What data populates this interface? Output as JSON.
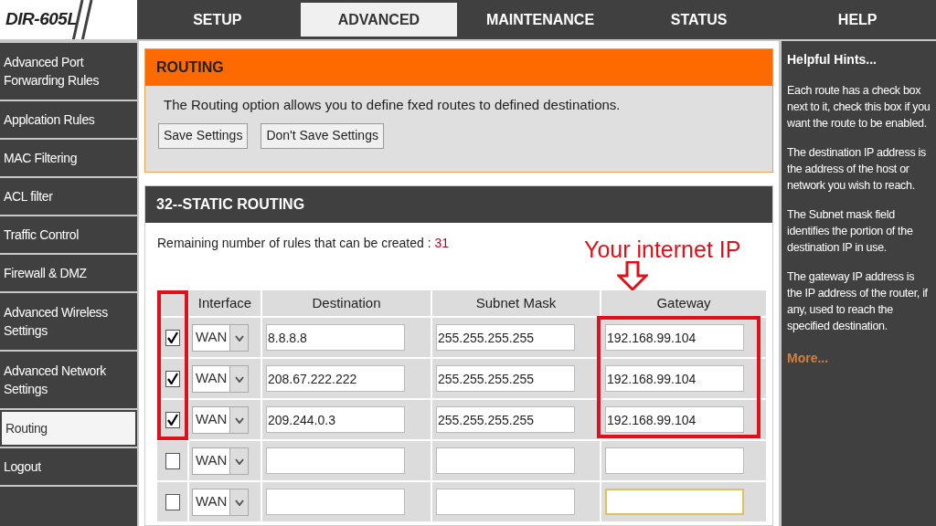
{
  "logo": "DIR-605L",
  "tabs": [
    {
      "label": "SETUP",
      "selected": false
    },
    {
      "label": "ADVANCED",
      "selected": true
    },
    {
      "label": "MAINTENANCE",
      "selected": false
    },
    {
      "label": "STATUS",
      "selected": false
    },
    {
      "label": "HELP",
      "selected": false
    }
  ],
  "sidebar": {
    "items": [
      {
        "label": "Advanced Port Forwarding Rules",
        "selected": false
      },
      {
        "label": "Applcation Rules",
        "selected": false
      },
      {
        "label": "MAC Filtering",
        "selected": false
      },
      {
        "label": "ACL filter",
        "selected": false
      },
      {
        "label": "Traffic Control",
        "selected": false
      },
      {
        "label": "Firewall & DMZ",
        "selected": false
      },
      {
        "label": "Advanced Wireless Settings",
        "selected": false
      },
      {
        "label": "Advanced Network Settings",
        "selected": false
      },
      {
        "label": "Routing",
        "selected": true
      },
      {
        "label": "Logout",
        "selected": false
      }
    ]
  },
  "routing": {
    "title": "ROUTING",
    "description": "The Routing option allows you to define fxed routes to defined destinations.",
    "buttons": [
      "Save Settings",
      "Don't Save Settings"
    ]
  },
  "static_routing": {
    "title": "32--STATIC ROUTING",
    "remaining_label": "Remaining number of rules that can be created :",
    "remaining_count": "31",
    "columns": [
      "Interface",
      "Destination",
      "Subnet Mask",
      "Gateway"
    ],
    "rows": [
      {
        "checked": true,
        "interface": "WAN",
        "destination": "8.8.8.8",
        "subnet_mask": "255.255.255.255",
        "gateway": "192.168.99.104",
        "focused": false
      },
      {
        "checked": true,
        "interface": "WAN",
        "destination": "208.67.222.222",
        "subnet_mask": "255.255.255.255",
        "gateway": "192.168.99.104",
        "focused": false
      },
      {
        "checked": true,
        "interface": "WAN",
        "destination": "209.244.0.3",
        "subnet_mask": "255.255.255.255",
        "gateway": "192.168.99.104",
        "focused": false
      },
      {
        "checked": false,
        "interface": "WAN",
        "focused": false
      },
      {
        "checked": false,
        "interface": "WAN",
        "focused": true
      }
    ]
  },
  "annotation": {
    "label": "Your internet IP"
  },
  "hints": {
    "title": "Helpful Hints...",
    "paragraphs": [
      "Each route has a check box next to it, check this box if you want the route to be enabled.",
      "The destination IP address is the address of the host or network you wish to reach.",
      "The Subnet mask field identifies the portion of the destination IP in use.",
      "The gateway IP address is the IP address of the router, if any, used to reach the specified destination."
    ],
    "more": "More..."
  }
}
